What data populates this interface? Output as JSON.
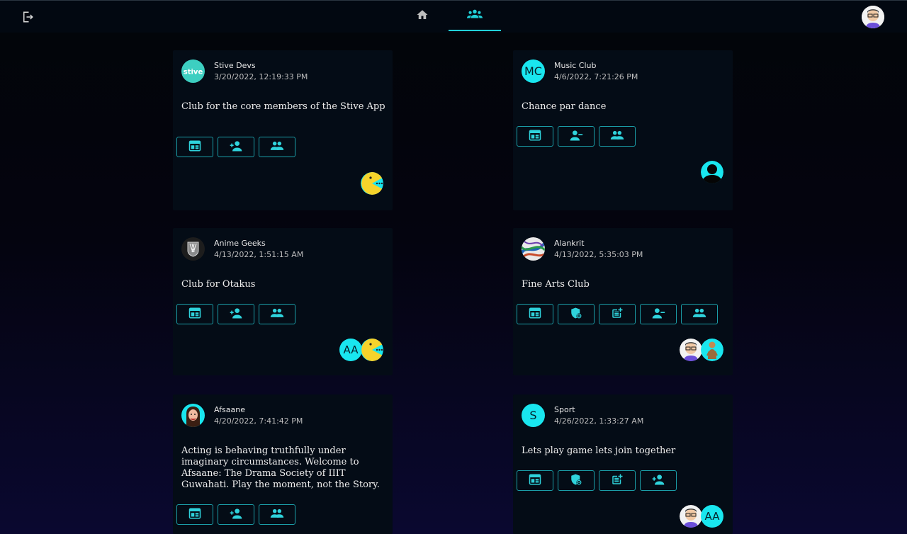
{
  "nav": {
    "tabs": [
      {
        "name": "home",
        "icon": "home-icon",
        "active": false
      },
      {
        "name": "clubs",
        "icon": "groups-icon",
        "active": true
      }
    ]
  },
  "colors": {
    "accent": "#21d0d8",
    "card_bg": "#040c16",
    "icon_teal": "#2fd3dc"
  },
  "cards": [
    {
      "name": "Stive Devs",
      "date": "3/20/2022, 12:19:33 PM",
      "avatar": {
        "type": "logo",
        "text": "stive"
      },
      "description": "Club for the core members of the Stive App",
      "actions": [
        "dashboard-icon",
        "person-add-icon",
        "groups-icon"
      ],
      "members": [
        {
          "type": "pacman"
        }
      ]
    },
    {
      "name": "Music Club",
      "date": "4/6/2022, 7:21:26 PM",
      "avatar": {
        "type": "letter",
        "text": "MC"
      },
      "description": "Chance par dance",
      "actions": [
        "dashboard-icon",
        "person-remove-icon",
        "groups-icon"
      ],
      "members": [
        {
          "type": "person"
        }
      ]
    },
    {
      "name": "Anime Geeks",
      "date": "4/13/2022, 1:51:15 AM",
      "avatar": {
        "type": "emblem"
      },
      "description": "Club for Otakus",
      "actions": [
        "dashboard-icon",
        "person-add-icon",
        "groups-icon"
      ],
      "members": [
        {
          "type": "letter",
          "text": "AA"
        },
        {
          "type": "pacman"
        }
      ]
    },
    {
      "name": "Alankrit",
      "date": "4/13/2022, 5:35:03 PM",
      "avatar": {
        "type": "art"
      },
      "description": "Fine Arts Club",
      "actions": [
        "dashboard-icon",
        "admin-shield-icon",
        "post-add-icon",
        "person-remove-icon",
        "groups-icon"
      ],
      "members": [
        {
          "type": "bitmoji"
        },
        {
          "type": "figure"
        }
      ]
    },
    {
      "name": "Afsaane",
      "date": "4/20/2022, 7:41:42 PM",
      "avatar": {
        "type": "face"
      },
      "description": "Acting is behaving truthfully under imaginary circumstances. Welcome to Afsaane: The Drama Society of IIIT Guwahati. Play the moment, not the Story.",
      "actions": [
        "dashboard-icon",
        "person-add-icon",
        "groups-icon"
      ],
      "members": []
    },
    {
      "name": "Sport",
      "date": "4/26/2022, 1:33:27 AM",
      "avatar": {
        "type": "letter",
        "text": "S"
      },
      "description": "Lets play game lets join together",
      "actions": [
        "dashboard-icon",
        "admin-shield-icon",
        "post-add-icon",
        "person-add-icon"
      ],
      "members": [
        {
          "type": "bitmoji"
        },
        {
          "type": "letter",
          "text": "AA"
        }
      ]
    }
  ]
}
